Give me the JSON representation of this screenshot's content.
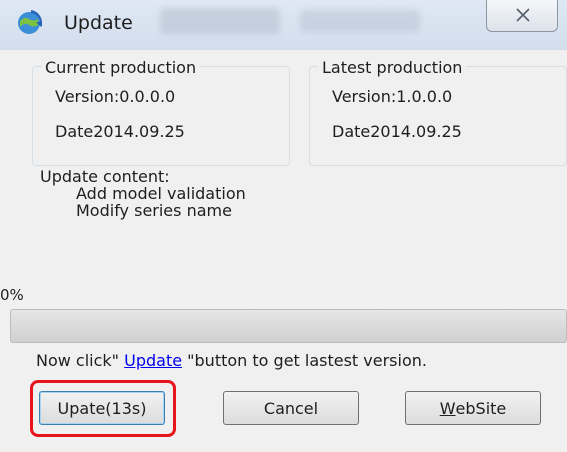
{
  "window": {
    "title": "Update",
    "close_glyph": "✕"
  },
  "current": {
    "legend": "Current production",
    "version": "Version:0.0.0.0",
    "date": "Date2014.09.25"
  },
  "latest": {
    "legend": "Latest production",
    "version": "Version:1.0.0.0",
    "date": "Date2014.09.25"
  },
  "content": {
    "heading": "Update content:",
    "items": [
      "Add model validation",
      "Modify series name"
    ]
  },
  "progress": {
    "label": "0%",
    "value": 0
  },
  "instruction": {
    "prefix": "Now click\" ",
    "link": "Update",
    "suffix": " \"button to get lastest version."
  },
  "buttons": {
    "update": "Upate(13s)",
    "cancel": "Cancel",
    "website_underlined": "W",
    "website_rest": "ebSite"
  },
  "colors": {
    "highlight": "#e8141c",
    "link": "#0000ee"
  },
  "icons": {
    "app": "update-globe-icon",
    "close": "close-icon"
  }
}
